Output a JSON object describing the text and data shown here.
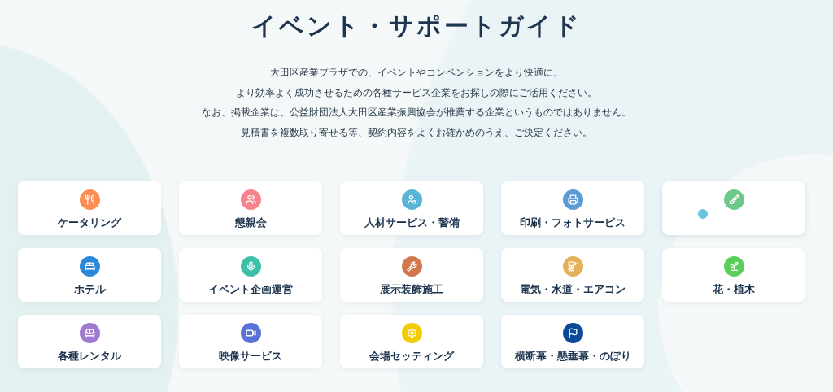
{
  "title": "イベント・サポートガイド",
  "intro": [
    "大田区産業プラザでの、イベントやコンベンションをより快適に、",
    "より効率よく成功させるための各種サービス企業をお探しの際にご活用ください。",
    "なお、掲載企業は、公益財団法人大田区産業振興協会が推薦する企業というものではありません。",
    "見積書を複数取り寄せる等、契約内容をよくお確かめのうえ、ご決定ください。"
  ],
  "categories": [
    {
      "label": "ケータリング",
      "color": "#ff8c50",
      "hover": false
    },
    {
      "label": "懇親会",
      "color": "#f6828c",
      "hover": false
    },
    {
      "label": "人材サービス・警備",
      "color": "#5ab4d6",
      "hover": false
    },
    {
      "label": "印刷・フォトサービス",
      "color": "#5a9bd5",
      "hover": false
    },
    {
      "color": "#6cc98a",
      "hover": true
    },
    {
      "label": "ホテル",
      "color": "#2a8ad8",
      "hover": false
    },
    {
      "label": "イベント企画運営",
      "color": "#3dbfa8",
      "hover": false
    },
    {
      "label": "展示装飾施工",
      "color": "#d2784e",
      "hover": false
    },
    {
      "label": "電気・水道・エアコン",
      "color": "#e6b05a",
      "hover": false
    },
    {
      "label": "花・植木",
      "color": "#5ccd5a",
      "hover": false
    },
    {
      "label": "各種レンタル",
      "color": "#a07ad0",
      "hover": false
    },
    {
      "label": "映像サービス",
      "color": "#5a72d8",
      "hover": false
    },
    {
      "label": "会場セッティング",
      "color": "#f0cc00",
      "hover": false
    },
    {
      "label": "横断幕・懸垂幕・のぼり",
      "color": "#0a4a96",
      "hover": false
    }
  ]
}
